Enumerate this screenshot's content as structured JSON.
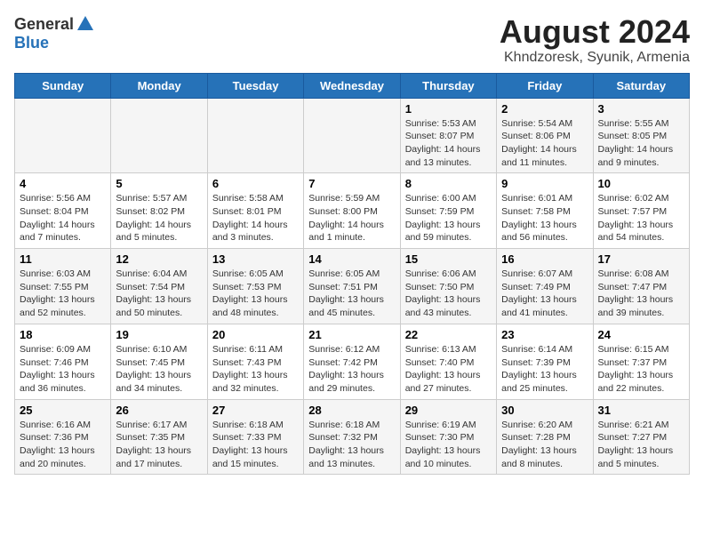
{
  "header": {
    "logo_line1": "General",
    "logo_line2": "Blue",
    "main_title": "August 2024",
    "sub_title": "Khndzoresk, Syunik, Armenia"
  },
  "days_of_week": [
    "Sunday",
    "Monday",
    "Tuesday",
    "Wednesday",
    "Thursday",
    "Friday",
    "Saturday"
  ],
  "weeks": [
    [
      {
        "day": "",
        "info": ""
      },
      {
        "day": "",
        "info": ""
      },
      {
        "day": "",
        "info": ""
      },
      {
        "day": "",
        "info": ""
      },
      {
        "day": "1",
        "info": "Sunrise: 5:53 AM\nSunset: 8:07 PM\nDaylight: 14 hours\nand 13 minutes."
      },
      {
        "day": "2",
        "info": "Sunrise: 5:54 AM\nSunset: 8:06 PM\nDaylight: 14 hours\nand 11 minutes."
      },
      {
        "day": "3",
        "info": "Sunrise: 5:55 AM\nSunset: 8:05 PM\nDaylight: 14 hours\nand 9 minutes."
      }
    ],
    [
      {
        "day": "4",
        "info": "Sunrise: 5:56 AM\nSunset: 8:04 PM\nDaylight: 14 hours\nand 7 minutes."
      },
      {
        "day": "5",
        "info": "Sunrise: 5:57 AM\nSunset: 8:02 PM\nDaylight: 14 hours\nand 5 minutes."
      },
      {
        "day": "6",
        "info": "Sunrise: 5:58 AM\nSunset: 8:01 PM\nDaylight: 14 hours\nand 3 minutes."
      },
      {
        "day": "7",
        "info": "Sunrise: 5:59 AM\nSunset: 8:00 PM\nDaylight: 14 hours\nand 1 minute."
      },
      {
        "day": "8",
        "info": "Sunrise: 6:00 AM\nSunset: 7:59 PM\nDaylight: 13 hours\nand 59 minutes."
      },
      {
        "day": "9",
        "info": "Sunrise: 6:01 AM\nSunset: 7:58 PM\nDaylight: 13 hours\nand 56 minutes."
      },
      {
        "day": "10",
        "info": "Sunrise: 6:02 AM\nSunset: 7:57 PM\nDaylight: 13 hours\nand 54 minutes."
      }
    ],
    [
      {
        "day": "11",
        "info": "Sunrise: 6:03 AM\nSunset: 7:55 PM\nDaylight: 13 hours\nand 52 minutes."
      },
      {
        "day": "12",
        "info": "Sunrise: 6:04 AM\nSunset: 7:54 PM\nDaylight: 13 hours\nand 50 minutes."
      },
      {
        "day": "13",
        "info": "Sunrise: 6:05 AM\nSunset: 7:53 PM\nDaylight: 13 hours\nand 48 minutes."
      },
      {
        "day": "14",
        "info": "Sunrise: 6:05 AM\nSunset: 7:51 PM\nDaylight: 13 hours\nand 45 minutes."
      },
      {
        "day": "15",
        "info": "Sunrise: 6:06 AM\nSunset: 7:50 PM\nDaylight: 13 hours\nand 43 minutes."
      },
      {
        "day": "16",
        "info": "Sunrise: 6:07 AM\nSunset: 7:49 PM\nDaylight: 13 hours\nand 41 minutes."
      },
      {
        "day": "17",
        "info": "Sunrise: 6:08 AM\nSunset: 7:47 PM\nDaylight: 13 hours\nand 39 minutes."
      }
    ],
    [
      {
        "day": "18",
        "info": "Sunrise: 6:09 AM\nSunset: 7:46 PM\nDaylight: 13 hours\nand 36 minutes."
      },
      {
        "day": "19",
        "info": "Sunrise: 6:10 AM\nSunset: 7:45 PM\nDaylight: 13 hours\nand 34 minutes."
      },
      {
        "day": "20",
        "info": "Sunrise: 6:11 AM\nSunset: 7:43 PM\nDaylight: 13 hours\nand 32 minutes."
      },
      {
        "day": "21",
        "info": "Sunrise: 6:12 AM\nSunset: 7:42 PM\nDaylight: 13 hours\nand 29 minutes."
      },
      {
        "day": "22",
        "info": "Sunrise: 6:13 AM\nSunset: 7:40 PM\nDaylight: 13 hours\nand 27 minutes."
      },
      {
        "day": "23",
        "info": "Sunrise: 6:14 AM\nSunset: 7:39 PM\nDaylight: 13 hours\nand 25 minutes."
      },
      {
        "day": "24",
        "info": "Sunrise: 6:15 AM\nSunset: 7:37 PM\nDaylight: 13 hours\nand 22 minutes."
      }
    ],
    [
      {
        "day": "25",
        "info": "Sunrise: 6:16 AM\nSunset: 7:36 PM\nDaylight: 13 hours\nand 20 minutes."
      },
      {
        "day": "26",
        "info": "Sunrise: 6:17 AM\nSunset: 7:35 PM\nDaylight: 13 hours\nand 17 minutes."
      },
      {
        "day": "27",
        "info": "Sunrise: 6:18 AM\nSunset: 7:33 PM\nDaylight: 13 hours\nand 15 minutes."
      },
      {
        "day": "28",
        "info": "Sunrise: 6:18 AM\nSunset: 7:32 PM\nDaylight: 13 hours\nand 13 minutes."
      },
      {
        "day": "29",
        "info": "Sunrise: 6:19 AM\nSunset: 7:30 PM\nDaylight: 13 hours\nand 10 minutes."
      },
      {
        "day": "30",
        "info": "Sunrise: 6:20 AM\nSunset: 7:28 PM\nDaylight: 13 hours\nand 8 minutes."
      },
      {
        "day": "31",
        "info": "Sunrise: 6:21 AM\nSunset: 7:27 PM\nDaylight: 13 hours\nand 5 minutes."
      }
    ]
  ]
}
